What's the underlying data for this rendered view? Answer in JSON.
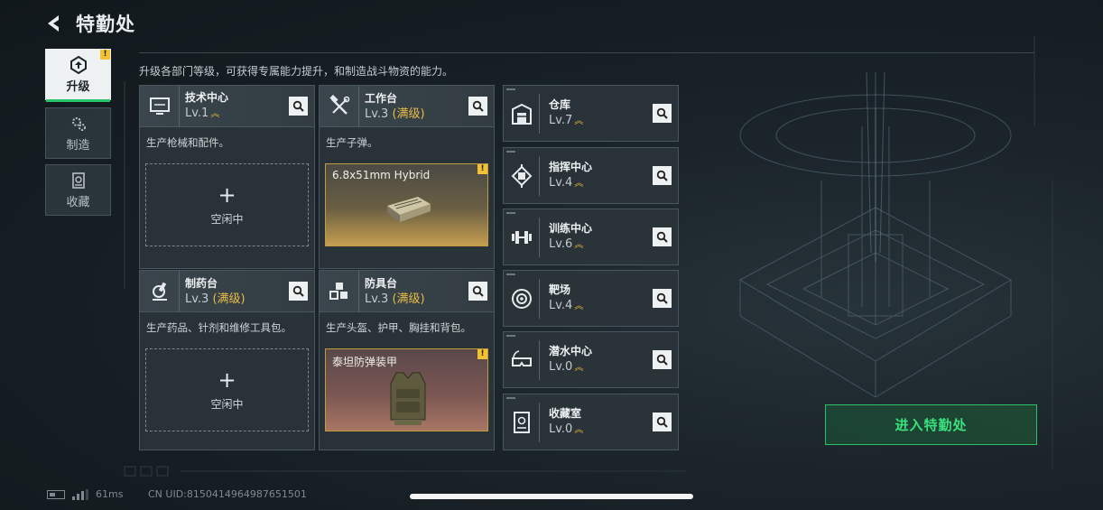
{
  "header": {
    "title": "特勤处"
  },
  "tabs": [
    {
      "label": "升级",
      "active": true,
      "badge": "!"
    },
    {
      "label": "制造",
      "active": false
    },
    {
      "label": "收藏",
      "active": false
    }
  ],
  "description": "升级各部门等级，可获得专属能力提升，和制造战斗物资的能力。",
  "workbenches": [
    {
      "name": "技术中心",
      "level": "Lv.1",
      "max_tag": "",
      "desc": "生产枪械和配件。",
      "slot": {
        "type": "idle",
        "label": "空闲中"
      }
    },
    {
      "name": "工作台",
      "level": "Lv.3",
      "max_tag": "(满级)",
      "desc": "生产子弹。",
      "slot": {
        "type": "product",
        "label": "6.8x51mm Hybrid",
        "badge": "!"
      }
    },
    {
      "name": "制药台",
      "level": "Lv.3",
      "max_tag": "(满级)",
      "desc": "生产药品、针剂和维修工具包。",
      "slot": {
        "type": "idle",
        "label": "空闲中"
      }
    },
    {
      "name": "防具台",
      "level": "Lv.3",
      "max_tag": "(满级)",
      "desc": "生产头盔、护甲、胸挂和背包。",
      "slot": {
        "type": "product",
        "label": "泰坦防弹装甲",
        "badge": "!"
      }
    }
  ],
  "facilities": [
    {
      "name": "仓库",
      "level": "Lv.7"
    },
    {
      "name": "指挥中心",
      "level": "Lv.4"
    },
    {
      "name": "训练中心",
      "level": "Lv.6"
    },
    {
      "name": "靶场",
      "level": "Lv.4"
    },
    {
      "name": "潜水中心",
      "level": "Lv.0"
    },
    {
      "name": "收藏室",
      "level": "Lv.0"
    }
  ],
  "enter_button": "进入特勤处",
  "status": {
    "ping": "61ms",
    "uid": "CN UID:8150414964987651501"
  },
  "colors": {
    "accent_green": "#27c36b",
    "level_gold": "#e0b33a",
    "badge_yellow": "#f1c232"
  }
}
